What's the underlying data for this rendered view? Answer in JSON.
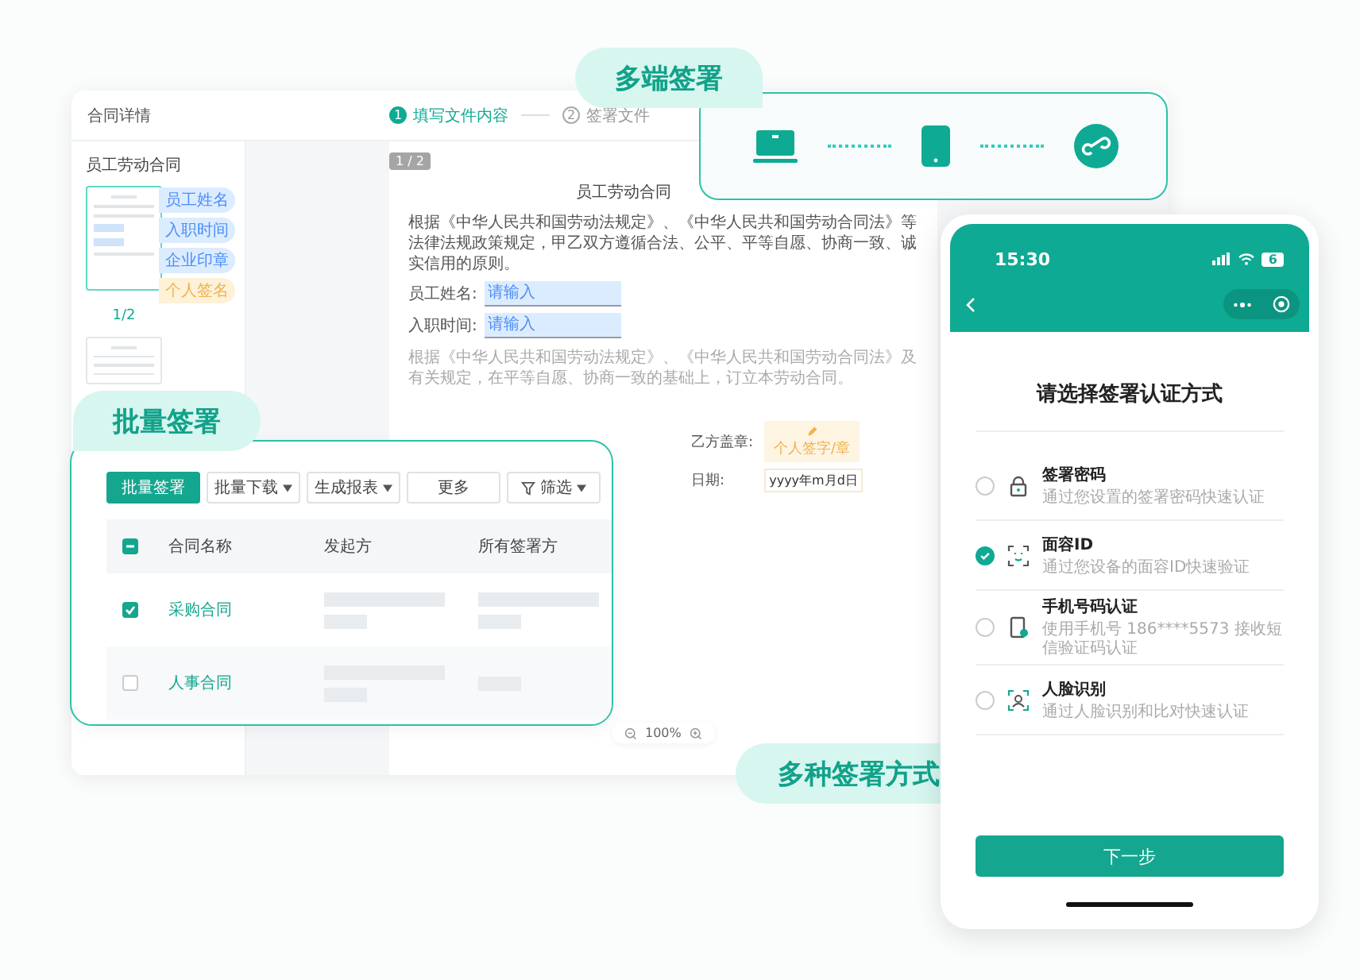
{
  "main_window": {
    "title": "合同详情",
    "steps": [
      {
        "number": "1",
        "label": "填写文件内容",
        "selected": true
      },
      {
        "number": "2",
        "label": "签署文件",
        "selected": false
      }
    ],
    "sidebar": {
      "title": "员工劳动合同",
      "tags": [
        {
          "label": "员工姓名",
          "kind": "field"
        },
        {
          "label": "入职时间",
          "kind": "field"
        },
        {
          "label": "企业印章",
          "kind": "field"
        },
        {
          "label": "个人签名",
          "kind": "signature"
        }
      ],
      "page_label": "1/2"
    },
    "document": {
      "page_badge": "1 / 2",
      "title": "员工劳动合同",
      "intro": "根据《中华人民共和国劳动法规定》、《中华人民共和国劳动合同法》等法律法规政策规定，甲乙双方遵循合法、公平、平等自愿、协商一致、诚实信用的原则。",
      "fields": [
        {
          "label": "员工姓名:",
          "placeholder": "请输入"
        },
        {
          "label": "入职时间:",
          "placeholder": "请输入"
        }
      ],
      "note": "根据《中华人民共和国劳动法规定》、《中华人民共和国劳动合同法》及有关规定，在平等自愿、协商一致的基础上，订立本劳动合同。",
      "seal_label": "乙方盖章:",
      "signature_box": "个人签字/章",
      "date_label": "日期:",
      "date_placeholder": "yyyy年m月d日"
    },
    "zoom": "100%"
  },
  "multi_device": {
    "label": "多端签署"
  },
  "batch": {
    "label": "批量签署",
    "toolbar": [
      {
        "label": "批量签署",
        "kind": "primary"
      },
      {
        "label": "批量下载",
        "kind": "dropdown"
      },
      {
        "label": "生成报表",
        "kind": "dropdown"
      },
      {
        "label": "更多",
        "kind": "plain"
      },
      {
        "label": "筛选",
        "kind": "filter"
      }
    ],
    "columns": [
      "合同名称",
      "发起方",
      "所有签署方"
    ],
    "header_indeterminate": true,
    "rows": [
      {
        "name": "采购合同",
        "checked": true
      },
      {
        "name": "人事合同",
        "checked": false
      }
    ]
  },
  "methods_label": "多种签署方式",
  "phone": {
    "time": "15:30",
    "battery": "6",
    "title": "请选择签署认证方式",
    "options": [
      {
        "kind": "password",
        "name": "签署密码",
        "description": "通过您设置的签署密码快速认证",
        "selected": false
      },
      {
        "kind": "faceid",
        "name": "面容ID",
        "description": "通过您设备的面容ID快速验证",
        "selected": true
      },
      {
        "kind": "sms",
        "name": "手机号码认证",
        "description": "使用手机号 186****5573 接收短信验证码认证",
        "selected": false
      },
      {
        "kind": "face",
        "name": "人脸识别",
        "description": "通过人脸识别和比对快速认证",
        "selected": false
      }
    ],
    "next_button": "下一步"
  }
}
